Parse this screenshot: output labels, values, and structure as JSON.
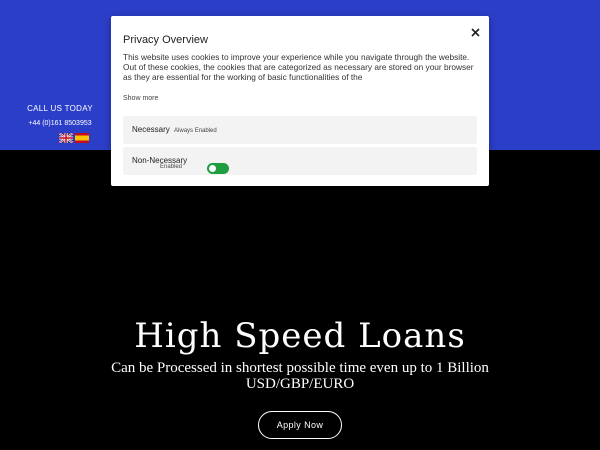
{
  "header": {
    "call_label": "CALL US TODAY",
    "phone": "+44 (0)161 8503953",
    "flags": [
      "uk-flag-icon",
      "spain-flag-icon"
    ],
    "band_color": "#2b3ec8"
  },
  "hero": {
    "title": "High Speed Loans",
    "subtitle": "Can be Processed in shortest possible time even up to 1 Billion USD/GBP/EURO",
    "apply_label": "Apply Now"
  },
  "privacy_modal": {
    "title": "Privacy Overview",
    "body": "This website uses cookies to improve your experience while you navigate through the website. Out of these cookies, the cookies that are categorized as necessary are stored on your browser as they are essential for the working of basic functionalities of the",
    "show_more": "Show more",
    "categories": [
      {
        "name": "Necessary",
        "status": "Always Enabled"
      },
      {
        "name": "Non-Necessary",
        "status": "Enabled",
        "enabled": true
      }
    ],
    "toggle_color": "#1f9e3f"
  }
}
